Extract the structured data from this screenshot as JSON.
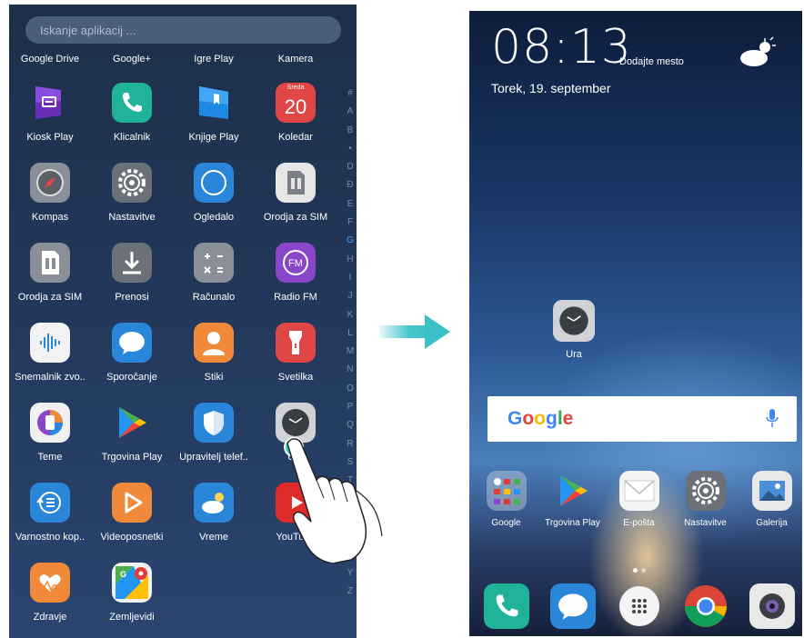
{
  "left_phone": {
    "search_placeholder": "Iskanje aplikacij ...",
    "top_row_labels": [
      "Google Drive",
      "Google+",
      "Igre Play",
      "Kamera"
    ],
    "apps": [
      {
        "label": "Kiosk Play",
        "icon": "kiosk-play-icon",
        "color": "#6a2db8"
      },
      {
        "label": "Klicalnik",
        "icon": "phone-icon",
        "color": "#20b39a"
      },
      {
        "label": "Knjige Play",
        "icon": "play-books-icon",
        "color": "#2a8fe0"
      },
      {
        "label": "Koledar",
        "icon": "calendar-icon",
        "color": "#e04646",
        "day_name": "Sreda",
        "day_number": "20"
      },
      {
        "label": "Kompas",
        "icon": "compass-icon",
        "color": "#8a8f98"
      },
      {
        "label": "Nastavitve",
        "icon": "gear-icon",
        "color": "#6c7078"
      },
      {
        "label": "Ogledalo",
        "icon": "mirror-icon",
        "color": "#2a86d8"
      },
      {
        "label": "Orodja za SIM",
        "icon": "sim-toolkit-icon",
        "color": "#e6e6e6"
      },
      {
        "label": "Orodja za SIM",
        "icon": "sim-toolkit-icon",
        "color": "#8a8f98"
      },
      {
        "label": "Prenosi",
        "icon": "download-icon",
        "color": "#6c7078"
      },
      {
        "label": "Računalo",
        "icon": "calculator-icon",
        "color": "#8a8f98"
      },
      {
        "label": "Radio FM",
        "icon": "radio-icon",
        "color": "#8a46c8"
      },
      {
        "label": "Snemalnik zvo..",
        "icon": "sound-recorder-icon",
        "color": "#f2f2f2"
      },
      {
        "label": "Sporočanje",
        "icon": "message-icon",
        "color": "#2a86d8"
      },
      {
        "label": "Stiki",
        "icon": "contacts-icon",
        "color": "#f08a3a"
      },
      {
        "label": "Svetilka",
        "icon": "flashlight-icon",
        "color": "#e04646"
      },
      {
        "label": "Teme",
        "icon": "themes-icon",
        "color": "#f0f0f0"
      },
      {
        "label": "Trgovina Play",
        "icon": "play-store-icon",
        "color": "transparent"
      },
      {
        "label": "Upravitelj telef..",
        "icon": "phone-manager-icon",
        "color": "#2a86d8"
      },
      {
        "label": "Ura",
        "icon": "clock-icon",
        "color": "#d0d2d6"
      },
      {
        "label": "Varnostno kop..",
        "icon": "backup-icon",
        "color": "#2a86d8"
      },
      {
        "label": "Videoposnetki",
        "icon": "videos-icon",
        "color": "#f08a3a"
      },
      {
        "label": "Vreme",
        "icon": "weather-icon",
        "color": "#2a86d8"
      },
      {
        "label": "YouTube",
        "icon": "youtube-icon",
        "color": "#e02b2b"
      },
      {
        "label": "Zdravje",
        "icon": "health-icon",
        "color": "#f08a3a"
      },
      {
        "label": "Zemljevidi",
        "icon": "maps-icon",
        "color": "#f2f2f2"
      }
    ],
    "alphabet": [
      "#",
      "A",
      "B",
      "•",
      "D",
      "Đ",
      "E",
      "F",
      "G",
      "H",
      "I",
      "J",
      "K",
      "L",
      "M",
      "N",
      "O",
      "P",
      "Q",
      "R",
      "S",
      "T",
      "U",
      "V",
      "W",
      "X",
      "Y",
      "Z"
    ],
    "active_letter": "G"
  },
  "right_phone": {
    "time": "08:13",
    "location_prompt": "Dodajte mesto",
    "date": "Torek, 19. september",
    "widget_app_label": "Ura",
    "google_logo": "Google",
    "dock_apps": [
      {
        "label": "Google",
        "icon": "google-folder-icon"
      },
      {
        "label": "Trgovina Play",
        "icon": "play-store-icon"
      },
      {
        "label": "E-pošta",
        "icon": "email-icon"
      },
      {
        "label": "Nastavitve",
        "icon": "gear-icon"
      },
      {
        "label": "Galerija",
        "icon": "gallery-icon"
      }
    ],
    "bottom_dock": [
      {
        "icon": "phone-icon"
      },
      {
        "icon": "message-icon"
      },
      {
        "icon": "app-drawer-icon"
      },
      {
        "icon": "chrome-icon"
      },
      {
        "icon": "camera-icon"
      }
    ]
  },
  "colors": {
    "arrow": "#3cc0c8",
    "touch_point": "#3cc8c0"
  }
}
